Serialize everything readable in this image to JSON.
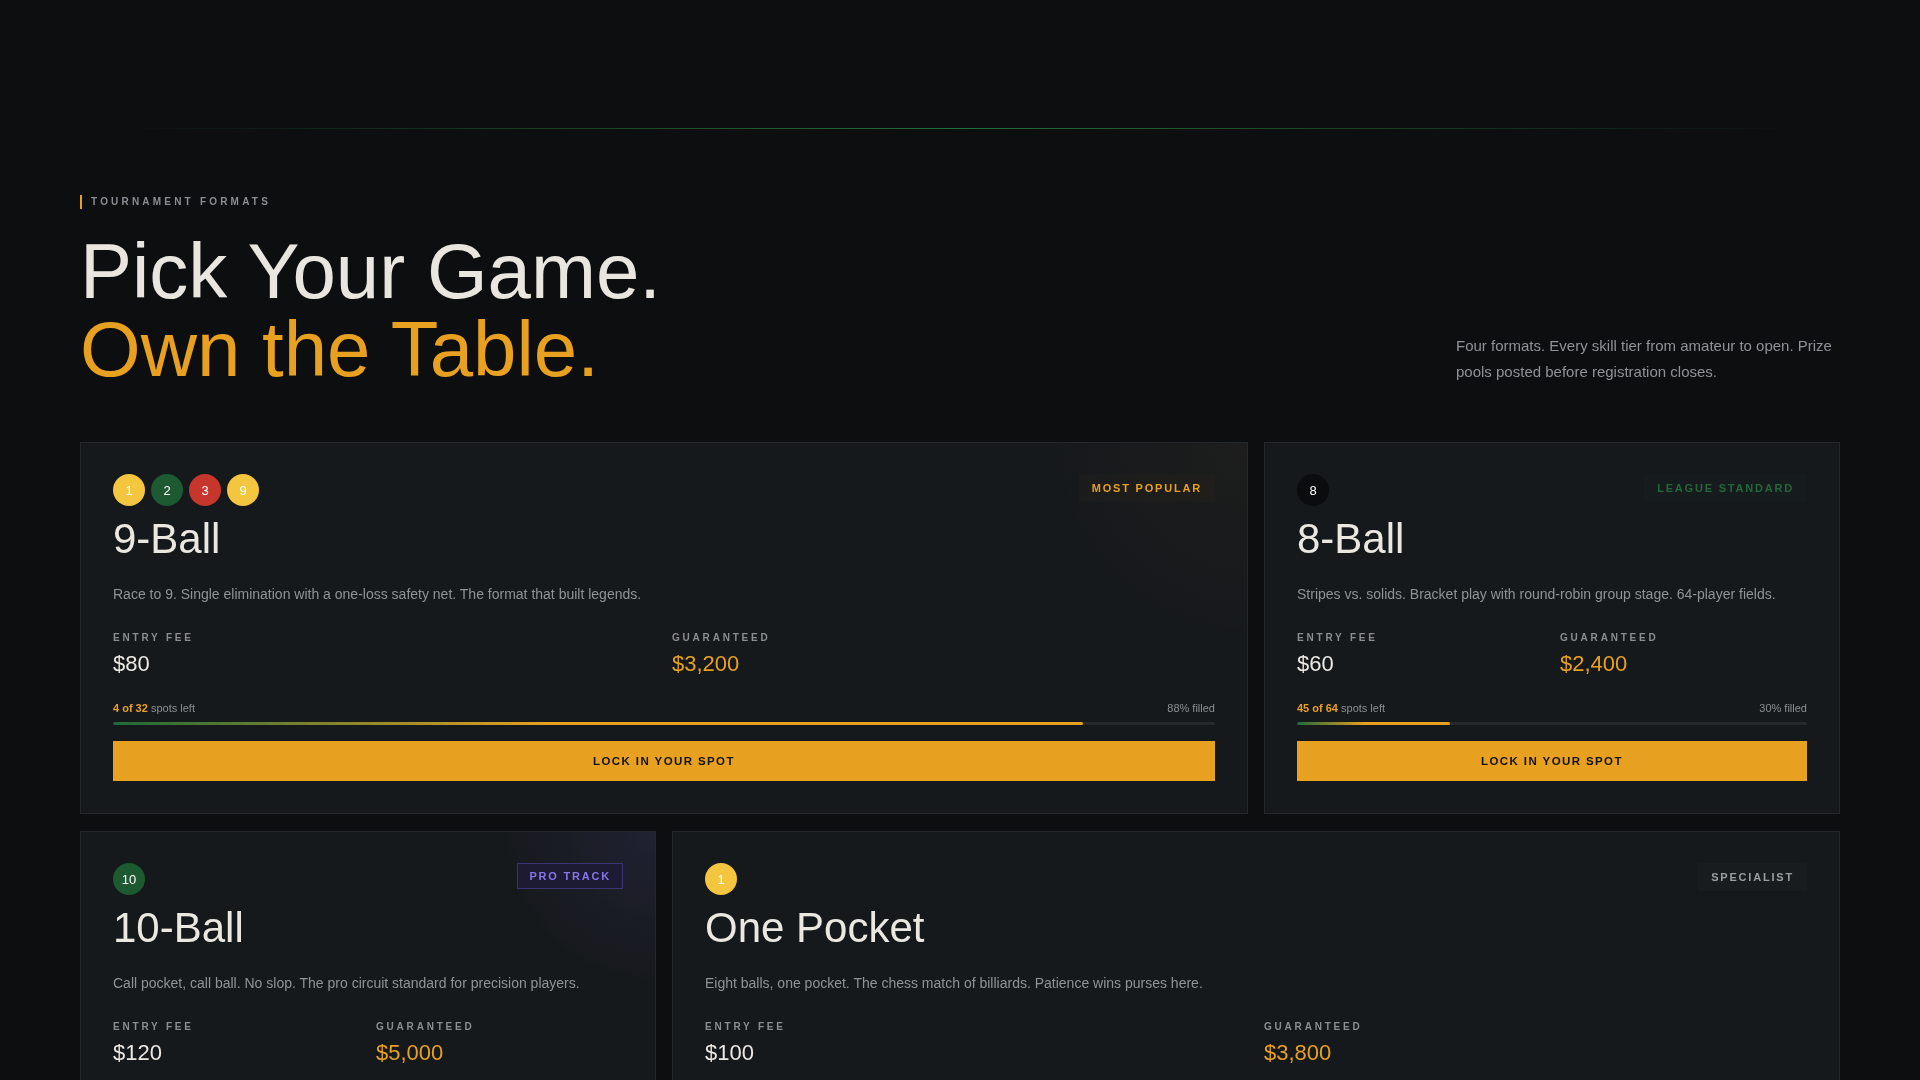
{
  "header": {
    "eyebrow": "TOURNAMENT FORMATS",
    "title_line_1": "Pick Your Game.",
    "title_line_2": "Own the Table.",
    "intro": "Four formats. Every skill tier from amateur to open. Prize pools posted before registration closes."
  },
  "cards": [
    {
      "balls": [
        {
          "number": "1",
          "color": "#f4c53f"
        },
        {
          "number": "2",
          "color": "#1d5a31"
        },
        {
          "number": "3",
          "color": "#c7362c"
        },
        {
          "number": "9",
          "color": "#f4c53f"
        }
      ],
      "badge": {
        "label": "MOST POPULAR",
        "kind": "popular"
      },
      "title": "9-Ball",
      "description": "Race to 9. Single elimination with a one-loss safety net. The format that built legends.",
      "stats": [
        {
          "label": "ENTRY FEE",
          "value": "$80",
          "kind": "fee"
        },
        {
          "label": "GUARANTEED",
          "value": "$3,200",
          "kind": "prize"
        }
      ],
      "progress": {
        "spots": "**4 of 32** spots left",
        "filled": "88% filled",
        "level": 0.88
      },
      "button": "LOCK IN YOUR SPOT"
    },
    {
      "balls": [
        {
          "number": "8",
          "color": "#0b0c0e"
        }
      ],
      "badge": {
        "label": "LEAGUE STANDARD",
        "kind": "league"
      },
      "title": "8-Ball",
      "description": "Stripes vs. solids. Bracket play with round-robin group stage. 64-player fields.",
      "stats": [
        {
          "label": "ENTRY FEE",
          "value": "$60",
          "kind": "fee"
        },
        {
          "label": "GUARANTEED",
          "value": "$2,400",
          "kind": "prize"
        }
      ],
      "progress": {
        "spots": "**45 of 64** spots left",
        "filled": "30% filled",
        "level": 0.3
      },
      "button": "LOCK IN YOUR SPOT"
    },
    {
      "balls": [
        {
          "number": "10",
          "color": "#1d5a31"
        }
      ],
      "badge": {
        "label": "PRO TRACK",
        "kind": "pro"
      },
      "title": "10-Ball",
      "description": "Call pocket, call ball. No slop. The pro circuit standard for precision players.",
      "stats": [
        {
          "label": "ENTRY FEE",
          "value": "$120",
          "kind": "fee"
        },
        {
          "label": "GUARANTEED",
          "value": "$5,000",
          "kind": "prize"
        }
      ]
    },
    {
      "balls": [
        {
          "number": "1",
          "color": "#f4c53f"
        }
      ],
      "badge": {
        "label": "SPECIALIST",
        "kind": "specialist"
      },
      "title": "One Pocket",
      "description": "Eight balls, one pocket. The chess match of billiards. Patience wins purses here.",
      "stats": [
        {
          "label": "ENTRY FEE",
          "value": "$100",
          "kind": "fee"
        },
        {
          "label": "GUARANTEED",
          "value": "$3,800",
          "kind": "prize"
        }
      ]
    }
  ]
}
